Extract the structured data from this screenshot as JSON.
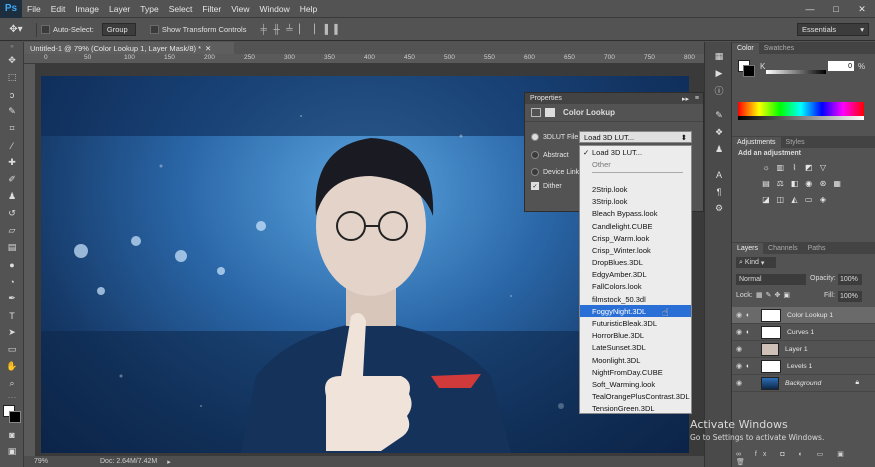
{
  "app": {
    "logo": "Ps"
  },
  "menu": [
    "File",
    "Edit",
    "Image",
    "Layer",
    "Type",
    "Select",
    "Filter",
    "View",
    "Window",
    "Help"
  ],
  "window_controls": [
    "—",
    "□",
    "✕"
  ],
  "options": {
    "auto_select_label": "Auto-Select:",
    "auto_select_value": "Group",
    "transform_label": "Show Transform Controls",
    "workspace": "Essentials"
  },
  "document": {
    "tab_title": "Untitled-1 @ 79% (Color Lookup 1, Layer Mask/8) *",
    "ruler_marks": [
      "0",
      "50",
      "100",
      "150",
      "200",
      "250",
      "300",
      "350",
      "400",
      "450",
      "500",
      "550",
      "600",
      "650",
      "700",
      "750",
      "800"
    ]
  },
  "status": {
    "zoom": "79%",
    "doc": "Doc: 2.64M/7.42M"
  },
  "properties": {
    "title": "Properties",
    "subtitle": "Color Lookup",
    "rows": [
      {
        "label": "3DLUT File",
        "checked": true
      },
      {
        "label": "Abstract",
        "checked": false
      },
      {
        "label": "Device Link",
        "checked": false
      },
      {
        "label": "Dither",
        "checked": true
      }
    ],
    "dropdown_value": "Load 3D LUT..."
  },
  "lut_list": {
    "header": "Load 3D LUT...",
    "other": "Other",
    "items": [
      "2Strip.look",
      "3Strip.look",
      "Bleach Bypass.look",
      "Candlelight.CUBE",
      "Crisp_Warm.look",
      "Crisp_Winter.look",
      "DropBlues.3DL",
      "EdgyAmber.3DL",
      "FallColors.look",
      "filmstock_50.3dl",
      "FoggyNight.3DL",
      "FuturisticBleak.3DL",
      "HorrorBlue.3DL",
      "LateSunset.3DL",
      "Moonlight.3DL",
      "NightFromDay.CUBE",
      "Soft_Warming.look",
      "TealOrangePlusContrast.3DL",
      "TensionGreen.3DL"
    ],
    "selected": "FoggyNight.3DL"
  },
  "color_panel": {
    "tabs": [
      "Color",
      "Swatches"
    ],
    "channel": "K",
    "value": "0",
    "unit": "%"
  },
  "adjust_panel": {
    "tabs": [
      "Adjustments",
      "Styles"
    ],
    "heading": "Add an adjustment"
  },
  "layers_panel": {
    "tabs": [
      "Layers",
      "Channels",
      "Paths"
    ],
    "kind": "Kind",
    "blend": "Normal",
    "opacity_label": "Opacity:",
    "opacity": "100%",
    "lock_label": "Lock:",
    "fill_label": "Fill:",
    "fill": "100%",
    "layers": [
      "Color Lookup 1",
      "Curves 1",
      "Layer 1",
      "Levels 1",
      "Background"
    ]
  },
  "watermark": {
    "title": "Activate Windows",
    "subtitle": "Go to Settings to activate Windows."
  },
  "colors": {
    "selection": "#2a6fd6",
    "ps_blue": "#3fa9f5"
  }
}
